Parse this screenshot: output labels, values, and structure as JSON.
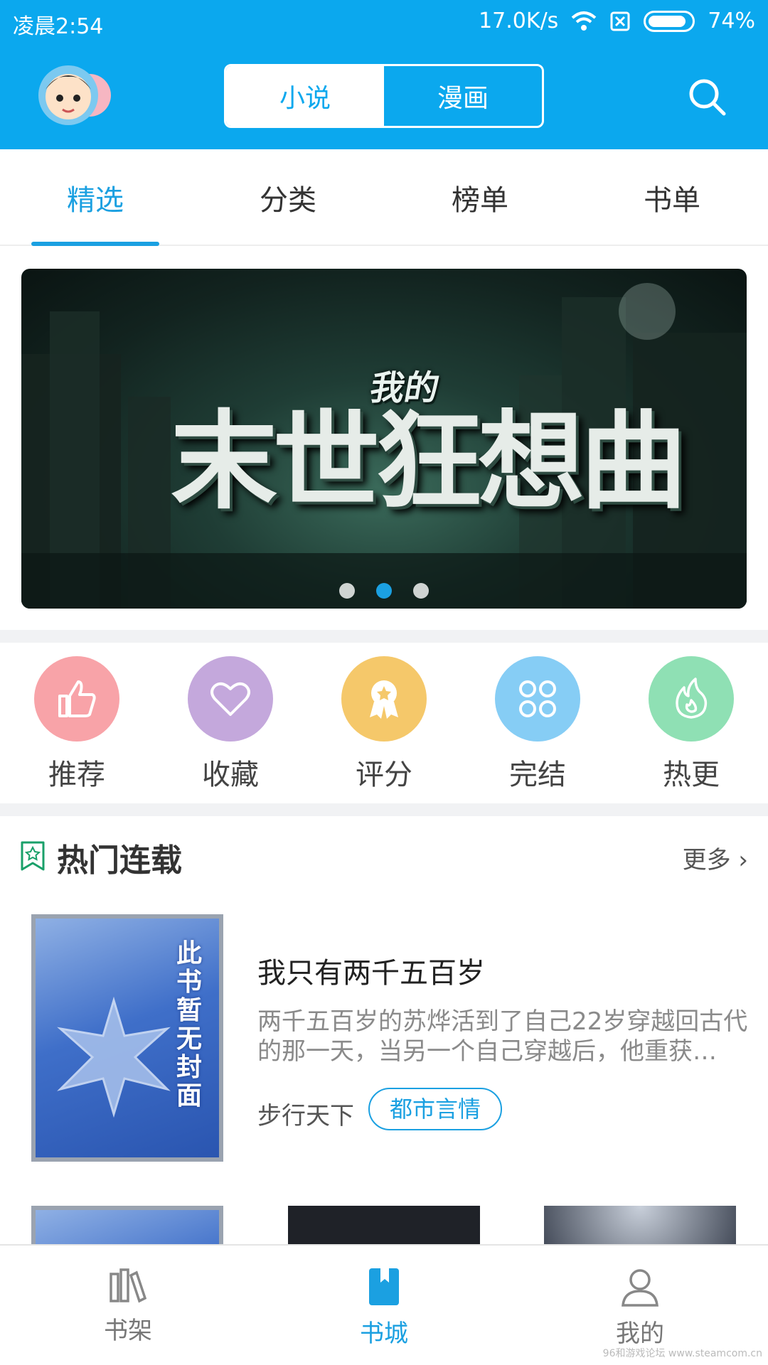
{
  "status": {
    "time": "凌晨2:54",
    "speed": "17.0K/s",
    "battery": "74%"
  },
  "header": {
    "segments": [
      "小说",
      "漫画"
    ],
    "active_segment": 0,
    "icons": {
      "avatar": "avatar-cartoon",
      "search": "search-icon"
    }
  },
  "tabs": [
    "精选",
    "分类",
    "榜单",
    "书单"
  ],
  "active_tab": 0,
  "banner": {
    "small_text": "我的",
    "big_text": "末世狂想曲",
    "slide_count": 3,
    "active_slide": 2
  },
  "categories": [
    {
      "label": "推荐",
      "icon": "thumbs-up-icon",
      "color": "#f8a3a8"
    },
    {
      "label": "收藏",
      "icon": "heart-icon",
      "color": "#c4a8dc"
    },
    {
      "label": "评分",
      "icon": "award-icon",
      "color": "#f5c86a"
    },
    {
      "label": "完结",
      "icon": "clover-icon",
      "color": "#86cdf5"
    },
    {
      "label": "热更",
      "icon": "flame-icon",
      "color": "#8fe0b4"
    }
  ],
  "hot": {
    "title": "热门连载",
    "more": "更多",
    "book": {
      "cover_text": "此书暂无封面",
      "title": "我只有两千五百岁",
      "desc": "两千五百岁的苏烨活到了自己22岁穿越回古代的那一天，当另一个自己穿越后，他重获…",
      "author": "步行天下",
      "tag": "都市言情"
    }
  },
  "bottom_nav": {
    "items": [
      "书架",
      "书城",
      "我的"
    ],
    "active": 1
  },
  "colors": {
    "primary": "#0ba8ee",
    "accent": "#1ba0e1"
  },
  "watermark": "96和游戏论坛 www.steamcom.cn"
}
